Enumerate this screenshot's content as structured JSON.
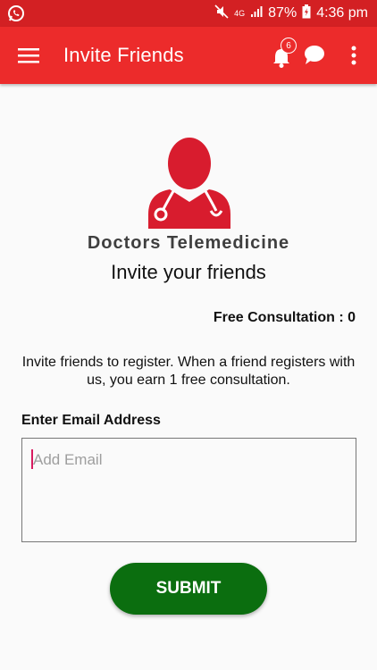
{
  "status_bar": {
    "network": "4G",
    "battery": "87%",
    "time": "4:36 pm",
    "icons": [
      "whatsapp-icon",
      "mute-icon",
      "signal-icon",
      "battery-charging-icon"
    ]
  },
  "app_bar": {
    "title": "Invite Friends",
    "notification_count": "6",
    "icons": [
      "menu-icon",
      "bell-icon",
      "chat-icon",
      "more-vert-icon"
    ]
  },
  "logo": {
    "brand_name": "Doctors Telemedicine",
    "icon": "doctor-icon"
  },
  "main": {
    "heading": "Invite your friends",
    "free_consultation": "Free Consultation : 0",
    "description": "Invite friends to register. When a friend registers with us, you earn 1 free consultation.",
    "email_label": "Enter Email Address",
    "email_placeholder": "Add Email",
    "email_value": "",
    "submit_label": "SUBMIT"
  },
  "colors": {
    "status_bar": "#d32023",
    "app_bar": "#ec2b2b",
    "logo_red": "#d81c2e",
    "submit_green": "#0b6e0f",
    "caret": "#d81b60"
  }
}
